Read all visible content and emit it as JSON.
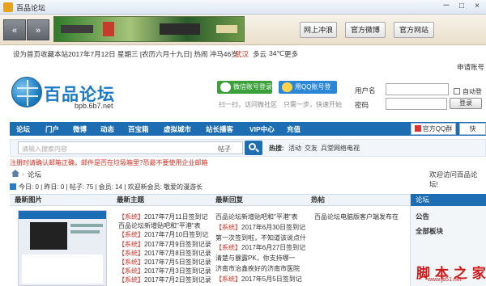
{
  "window": {
    "title": "百品论坛",
    "minimize": "－",
    "maximize": "□",
    "close": "×"
  },
  "toolbar": {
    "back": "«",
    "forward": "»",
    "buttons": [
      "网上冲浪",
      "官方微博",
      "官方网站"
    ]
  },
  "info": {
    "items": [
      "设为首页",
      "收藏本站",
      "2017年7月12日 星期三 [农历六月十九日] 热闹 冲马46岁"
    ],
    "weather_city": "武汉",
    "weather_text": "多云",
    "temperature": "34℃",
    "more": "更多",
    "register": "申请账号"
  },
  "logo": {
    "text": "百品论坛",
    "url": "bpb.6b7.net"
  },
  "social": {
    "wechat_label": "微信账号登录",
    "wechat_tip": "扫一扫，访问微社区",
    "qq_label": "用QQ账号登录",
    "qq_tip": "只需一步，快速开始"
  },
  "login": {
    "username_label": "用户名",
    "password_label": "密码",
    "remember": "自动登",
    "submit": "登录"
  },
  "nav": {
    "items": [
      "论坛",
      "门户",
      "微博",
      "动态",
      "百宝箱",
      "虚拟城市",
      "站长播客",
      "VIP中心",
      "充值"
    ],
    "qq_group": "官方QQ群",
    "quick": "快"
  },
  "search": {
    "placeholder": "请输入搜索内容",
    "type": "帖子",
    "hot_label": "热搜:",
    "hot_items": [
      "活动",
      "交友",
      "兵堂网络电视"
    ]
  },
  "notice": "注册时请确认邮箱正确，邮件是否在垃圾箱里?恐最不要使用企业邮箱",
  "breadcrumb": {
    "current": "论坛",
    "welcome": "欢迎访问百品论坛!"
  },
  "stats": "今日: 0 | 昨日: 0 | 帖子: 75 | 会员: 14 | 欢迎新会员: 敬爱的漫游长",
  "columns": {
    "latest_images": "最新图片",
    "latest_topics": "最新主题",
    "latest_replies": "最新回复",
    "hot_posts": "热帖"
  },
  "topics": [
    {
      "tag": "【系统】",
      "text": "2017年7月11日签到记"
    },
    {
      "tag": "",
      "text": "百品论坛新增贴吧和\"平港\"表"
    },
    {
      "tag": "【系统】",
      "text": "2017年7月10日签到记"
    },
    {
      "tag": "【系统】",
      "text": "2017年7月9日签到记录"
    },
    {
      "tag": "【系统】",
      "text": "2017年7月8日签到记录"
    },
    {
      "tag": "【系统】",
      "text": "2017年7月5日签到记录"
    },
    {
      "tag": "【系统】",
      "text": "2017年7月3日签到记录"
    },
    {
      "tag": "【系统】",
      "text": "2017年7月2日签到记录"
    }
  ],
  "replies": [
    {
      "tag": "",
      "text": "百品论坛新增贴吧和\"平港\"表"
    },
    {
      "tag": "【系统】",
      "text": "2017年6月30日签到记"
    },
    {
      "tag": "",
      "text": "第一次签到啦，不知道该说点什"
    },
    {
      "tag": "【系统】",
      "text": "2017年6月27日签到记"
    },
    {
      "tag": "",
      "text": "清楚与暴露PK，你支持哪一"
    },
    {
      "tag": "",
      "text": "济南市治鑫疾好的济南市医院"
    },
    {
      "tag": "【系统】",
      "text": "2017年5月5日签到记"
    }
  ],
  "hot": [
    "百品论坛电脑版客户端发布在"
  ],
  "sidebar": {
    "header": "论坛",
    "items": [
      "公告",
      "全部板块"
    ]
  },
  "watermark": {
    "text": "脚 本 之 家",
    "url": "www.jb51.net"
  }
}
